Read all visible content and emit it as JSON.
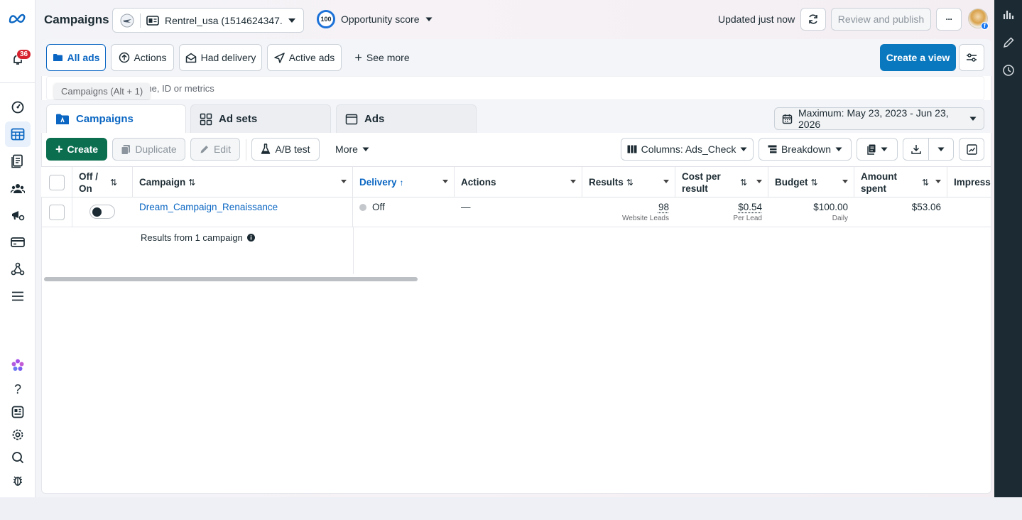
{
  "header": {
    "title": "Campaigns",
    "account_name": "Rentrel_usa (1514624347...",
    "opportunity_score_value": "100",
    "opportunity_score_label": "Opportunity score",
    "updated_text": "Updated just now",
    "review_publish_label": "Review and publish",
    "more_label": "···",
    "avatar_badge": "f"
  },
  "leftnav": {
    "notifications_count": "36",
    "items": [
      "meta-logo",
      "notifications",
      "account-overview",
      "campaigns",
      "reports",
      "audiences",
      "advertising-settings",
      "billing",
      "events-manager",
      "all-tools",
      "meta-ai",
      "help",
      "news",
      "settings",
      "search",
      "report-bug"
    ]
  },
  "views": {
    "all_ads": "All ads",
    "actions": "Actions",
    "had_delivery": "Had delivery",
    "active_ads": "Active ads",
    "see_more": "See more",
    "create_view": "Create a view"
  },
  "search": {
    "placeholder": "Search to filter by: name, ID or metrics",
    "tooltip": "Campaigns (Alt + 1)"
  },
  "tabs": {
    "campaigns": "Campaigns",
    "ad_sets": "Ad sets",
    "ads": "Ads"
  },
  "date_range": "Maximum: May 23, 2023 - Jun 23, 2026",
  "toolbar": {
    "create": "Create",
    "duplicate": "Duplicate",
    "edit": "Edit",
    "ab_test": "A/B test",
    "more": "More",
    "columns": "Columns: Ads_Check",
    "breakdown": "Breakdown"
  },
  "table": {
    "headers": {
      "off_on": "Off / On",
      "campaign": "Campaign",
      "delivery": "Delivery",
      "actions": "Actions",
      "results": "Results",
      "cost_per_result": "Cost per result",
      "budget": "Budget",
      "amount_spent": "Amount spent",
      "impressions": "Impressi"
    },
    "row": {
      "campaign_name": "Dream_Campaign_Renaissance",
      "delivery": "Off",
      "actions": "—",
      "results": "98",
      "results_sub": "Website Leads",
      "cost_per_result": "$0.54",
      "cost_per_result_sub": "Per Lead",
      "budget": "$100.00",
      "budget_sub": "Daily",
      "amount_spent": "$53.06"
    },
    "footer": "Results from 1 campaign"
  },
  "colors": {
    "accent_blue": "#0a78be",
    "create_green": "#0b6e4f",
    "right_rail": "#1c2b33",
    "badge_red": "#d6212f"
  }
}
